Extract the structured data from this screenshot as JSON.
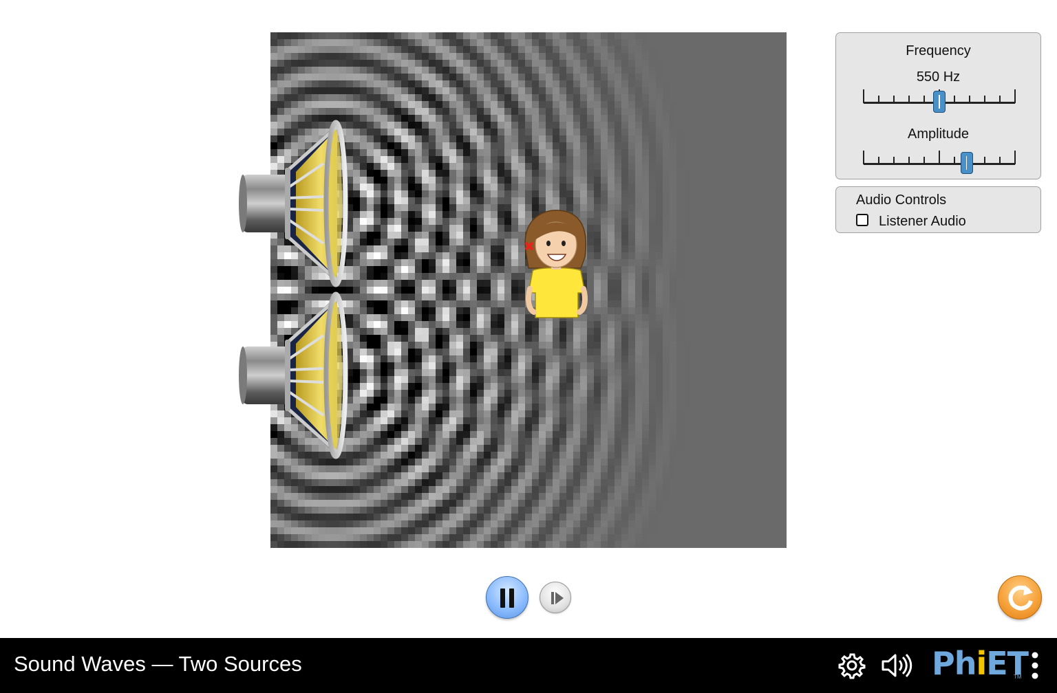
{
  "app": {
    "title": "Sound Waves — Two Sources"
  },
  "controls": {
    "frequency": {
      "label": "Frequency",
      "value_text": "550 Hz",
      "slider_fraction": 0.5
    },
    "amplitude": {
      "label": "Amplitude",
      "slider_fraction": 0.68
    }
  },
  "audio_controls": {
    "title": "Audio Controls",
    "listener_audio_label": "Listener Audio",
    "listener_audio_checked": false
  },
  "playback": {
    "playing": true
  },
  "navbar": {
    "logo_text": "PhET",
    "icons": [
      "gear-icon",
      "speaker-icon",
      "kebab-menu-icon"
    ]
  },
  "colors": {
    "wave_background": "#6a6a6a",
    "slider_thumb": "#4a90c8",
    "play_button": "#8cbcff",
    "reset_button": "#f6a23a",
    "navbar": "#000000",
    "phet_blue": "#6fa8dc",
    "phet_yellow": "#f5c400",
    "listener_shirt": "#ffe63b",
    "marker_x": "#e8231c"
  }
}
